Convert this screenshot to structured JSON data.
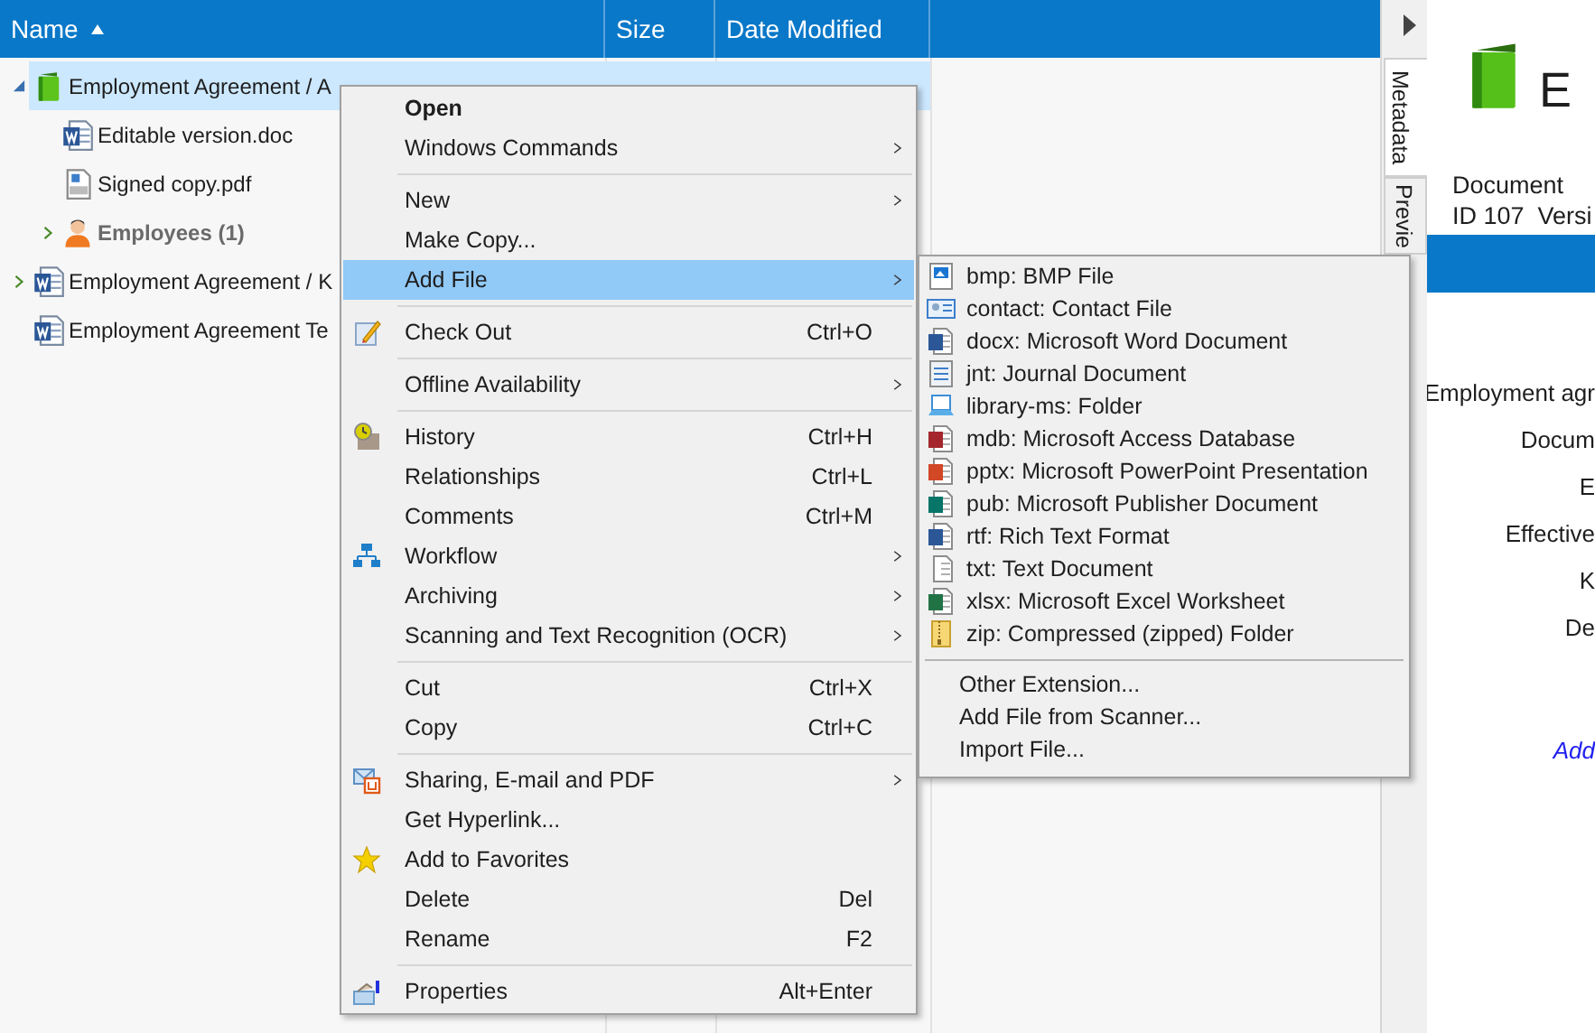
{
  "columns": [
    {
      "label": "Name",
      "sorted": true
    },
    {
      "label": "Size",
      "sorted": false
    },
    {
      "label": "Date Modified",
      "sorted": false
    }
  ],
  "tree": [
    {
      "kind": "record",
      "name": "Employment Agreement / A",
      "selected": true,
      "expanded": true,
      "children": [
        {
          "kind": "word-file",
          "name": "Editable version.doc",
          "selected": false
        },
        {
          "kind": "pdf-file",
          "name": "Signed copy.pdf",
          "selected": false
        },
        {
          "kind": "group",
          "name": "Employees (1)",
          "selected": false,
          "expanded": false
        }
      ]
    },
    {
      "kind": "word-file",
      "name": "Employment Agreement / K",
      "selected": false,
      "expanded": false
    },
    {
      "kind": "word-file",
      "name": "Employment Agreement Te",
      "selected": false
    }
  ],
  "context_menu": [
    {
      "kind": "item",
      "label": "Open",
      "default": true,
      "submenu": false,
      "selected": false
    },
    {
      "kind": "item",
      "label": "Windows Commands",
      "submenu": true,
      "selected": false
    },
    {
      "kind": "separator"
    },
    {
      "kind": "item",
      "label": "New",
      "submenu": true,
      "selected": false
    },
    {
      "kind": "item",
      "label": "Make Copy...",
      "submenu": false,
      "selected": false
    },
    {
      "kind": "item",
      "label": "Add File",
      "submenu": true,
      "selected": true
    },
    {
      "kind": "separator"
    },
    {
      "kind": "item",
      "label": "Check Out",
      "shortcut": "Ctrl+O",
      "submenu": false,
      "selected": false
    },
    {
      "kind": "separator"
    },
    {
      "kind": "item",
      "label": "Offline Availability",
      "submenu": true,
      "selected": false
    },
    {
      "kind": "separator"
    },
    {
      "kind": "item",
      "label": "History",
      "shortcut": "Ctrl+H",
      "submenu": false,
      "selected": false
    },
    {
      "kind": "item",
      "label": "Relationships",
      "shortcut": "Ctrl+L",
      "submenu": false,
      "selected": false
    },
    {
      "kind": "item",
      "label": "Comments",
      "shortcut": "Ctrl+M",
      "submenu": false,
      "selected": false
    },
    {
      "kind": "item",
      "label": "Workflow",
      "submenu": true,
      "selected": false
    },
    {
      "kind": "item",
      "label": "Archiving",
      "submenu": true,
      "selected": false
    },
    {
      "kind": "item",
      "label": "Scanning and Text Recognition (OCR)",
      "submenu": true,
      "selected": false
    },
    {
      "kind": "separator"
    },
    {
      "kind": "item",
      "label": "Cut",
      "shortcut": "Ctrl+X",
      "submenu": false,
      "selected": false
    },
    {
      "kind": "item",
      "label": "Copy",
      "shortcut": "Ctrl+C",
      "submenu": false,
      "selected": false
    },
    {
      "kind": "separator"
    },
    {
      "kind": "item",
      "label": "Sharing, E-mail and PDF",
      "submenu": true,
      "selected": false
    },
    {
      "kind": "item",
      "label": "Get Hyperlink...",
      "submenu": false,
      "selected": false
    },
    {
      "kind": "item",
      "label": "Add to Favorites",
      "submenu": false,
      "selected": false
    },
    {
      "kind": "item",
      "label": "Delete",
      "shortcut": "Del",
      "submenu": false,
      "selected": false
    },
    {
      "kind": "item",
      "label": "Rename",
      "shortcut": "F2",
      "submenu": false,
      "selected": false
    },
    {
      "kind": "separator"
    },
    {
      "kind": "item",
      "label": "Properties",
      "shortcut": "Alt+Enter",
      "submenu": false,
      "selected": false
    }
  ],
  "submenu": [
    {
      "kind": "file-type",
      "label": "bmp: BMP File"
    },
    {
      "kind": "file-type",
      "label": "contact: Contact File"
    },
    {
      "kind": "file-type",
      "label": "docx: Microsoft Word Document"
    },
    {
      "kind": "file-type",
      "label": "jnt: Journal Document"
    },
    {
      "kind": "file-type",
      "label": "library-ms: Folder"
    },
    {
      "kind": "file-type",
      "label": "mdb: Microsoft Access Database"
    },
    {
      "kind": "file-type",
      "label": "pptx: Microsoft PowerPoint Presentation"
    },
    {
      "kind": "file-type",
      "label": "pub: Microsoft Publisher Document"
    },
    {
      "kind": "file-type",
      "label": "rtf: Rich Text Format"
    },
    {
      "kind": "file-type",
      "label": "txt: Text Document"
    },
    {
      "kind": "file-type",
      "label": "xlsx: Microsoft Excel Worksheet"
    },
    {
      "kind": "file-type",
      "label": "zip: Compressed (zipped) Folder"
    },
    {
      "kind": "separator"
    },
    {
      "kind": "command",
      "label": "Other Extension..."
    },
    {
      "kind": "command",
      "label": "Add File from Scanner..."
    },
    {
      "kind": "command",
      "label": "Import File..."
    }
  ],
  "side_tabs": [
    {
      "label": "Metadata",
      "selected": true
    },
    {
      "label": "Previe",
      "selected": false
    }
  ],
  "details": {
    "title": "E",
    "type": "Document",
    "id_line": "ID 107  Versi",
    "fields": [
      "Employment agr",
      "Docum",
      "E",
      "Effective",
      "K",
      "De"
    ],
    "link": "Add"
  }
}
